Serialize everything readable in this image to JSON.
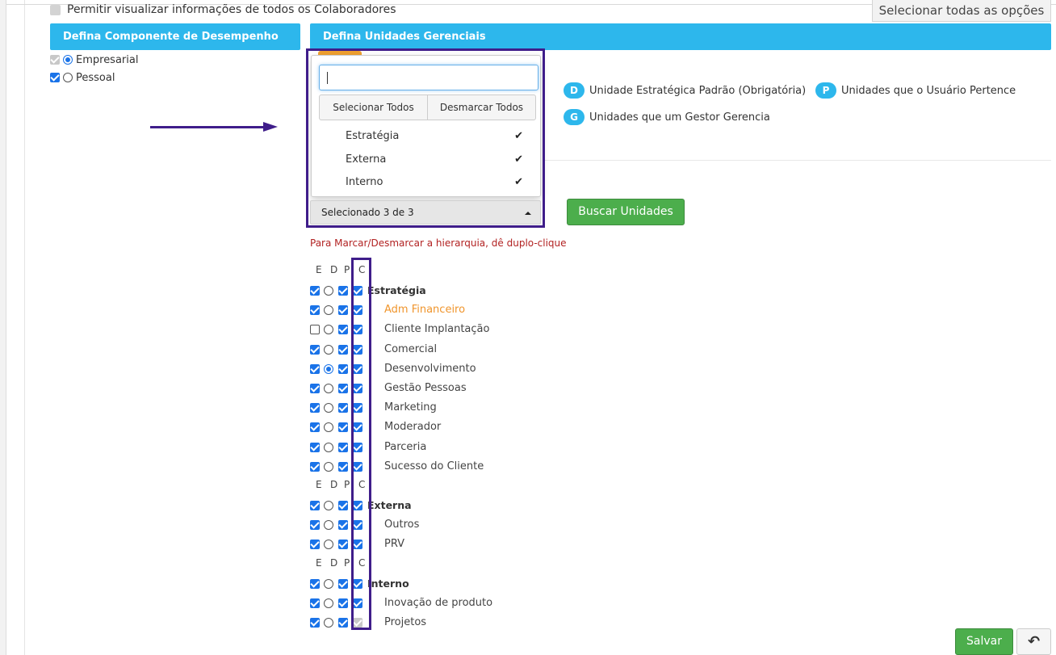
{
  "top": {
    "allow_all_label": "Permitir visualizar informações de todos os Colaboradores",
    "select_all_options": "Selecionar todas as opções"
  },
  "performance": {
    "header": "Defina Componente de Desempenho",
    "options": [
      {
        "label": "Empresarial",
        "checked": true,
        "radio": true,
        "disabled": true
      },
      {
        "label": "Pessoal",
        "checked": true,
        "radio": false,
        "disabled": false
      }
    ]
  },
  "units": {
    "header": "Defina Unidades Gerenciais",
    "legend": [
      {
        "badge": "D",
        "label": "Unidade Estratégica Padrão (Obrigatória)"
      },
      {
        "badge": "P",
        "label": "Unidades que o Usuário Pertence"
      },
      {
        "badge": "G",
        "label": "Unidades que um Gestor Gerencia"
      }
    ],
    "dropdown": {
      "search_value": "",
      "select_all": "Selecionar Todos",
      "deselect_all": "Desmarcar Todos",
      "options": [
        {
          "label": "Estratégia",
          "checked": true
        },
        {
          "label": "Externa",
          "checked": true
        },
        {
          "label": "Interno",
          "checked": true
        }
      ],
      "button_label": "Selecionado 3 de 3"
    },
    "search_button": "Buscar Unidades",
    "hint": "Para Marcar/Desmarcar a hierarquia, dê duplo-clique",
    "columns": [
      "E",
      "D",
      "P",
      "C"
    ],
    "groups": [
      {
        "name": "Estratégia",
        "row": {
          "e": true,
          "d": false,
          "p": true,
          "c": true
        },
        "items": [
          {
            "name": "Adm Financeiro",
            "highlight": true,
            "e": true,
            "d": false,
            "p": true,
            "c": true
          },
          {
            "name": "Cliente Implantação",
            "e": false,
            "d": false,
            "p": true,
            "c": true
          },
          {
            "name": "Comercial",
            "e": true,
            "d": false,
            "p": true,
            "c": true
          },
          {
            "name": "Desenvolvimento",
            "e": true,
            "d": true,
            "p": true,
            "c": true
          },
          {
            "name": "Gestão Pessoas",
            "e": true,
            "d": false,
            "p": true,
            "c": true
          },
          {
            "name": "Marketing",
            "e": true,
            "d": false,
            "p": true,
            "c": true
          },
          {
            "name": "Moderador",
            "e": true,
            "d": false,
            "p": true,
            "c": true
          },
          {
            "name": "Parceria",
            "e": true,
            "d": false,
            "p": true,
            "c": true
          },
          {
            "name": "Sucesso do Cliente",
            "e": true,
            "d": false,
            "p": true,
            "c": true
          }
        ]
      },
      {
        "name": "Externa",
        "row": {
          "e": true,
          "d": false,
          "p": true,
          "c": true
        },
        "items": [
          {
            "name": "Outros",
            "e": true,
            "d": false,
            "p": true,
            "c": true
          },
          {
            "name": "PRV",
            "e": true,
            "d": false,
            "p": true,
            "c": true
          }
        ]
      },
      {
        "name": "Interno",
        "row": {
          "e": true,
          "d": false,
          "p": true,
          "c": true
        },
        "items": [
          {
            "name": "Inovação de produto",
            "e": true,
            "d": false,
            "p": true,
            "c": true
          },
          {
            "name": "Projetos",
            "e": true,
            "d": false,
            "p": true,
            "c": true,
            "c_disabled": true
          }
        ]
      }
    ]
  },
  "footer": {
    "save": "Salvar",
    "undo_icon": "undo-icon"
  },
  "colors": {
    "header_blue": "#2db7ec",
    "checkbox_blue": "#1a73e8",
    "annotation_purple": "#3f1d8a",
    "success_green": "#4cae4c",
    "hint_red": "#b22222",
    "highlight_orange": "#f0952c"
  }
}
